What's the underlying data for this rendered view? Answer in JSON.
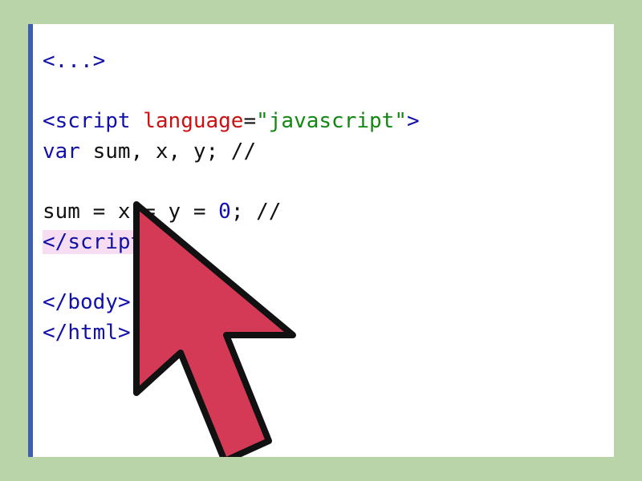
{
  "code": {
    "line0": {
      "truncated_open": "<...",
      "truncated_close": ">"
    },
    "line2": {
      "tag_open": "<",
      "tag_name": "script",
      "attr_name": "language",
      "eq": "=",
      "quote1": "\"",
      "attr_val": "javascript",
      "quote2": "\"",
      "tag_close": ">"
    },
    "line3": {
      "kw": "var",
      "rest": " sum, x, y; //"
    },
    "line5": {
      "assign": "sum = x = y = ",
      "zero": "0",
      "semi_comment": "; //"
    },
    "line6": {
      "close_open": "</",
      "close_name": "script",
      "close_gt": ">"
    },
    "line8": {
      "open": "</",
      "name": "body",
      "gt": ">"
    },
    "line9": {
      "open": "</",
      "name": "html",
      "gt": ">"
    }
  },
  "overlay": {
    "cursor_type": "large-red-arrow-pointer"
  }
}
